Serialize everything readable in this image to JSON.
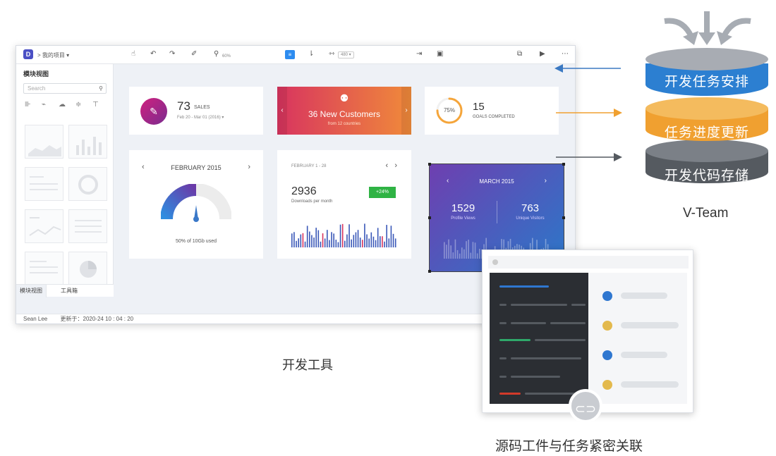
{
  "toolbar": {
    "logo": "D",
    "breadcrumb": "> 我的项目 ▾",
    "zoom": "60%",
    "select_value": "480 ▾"
  },
  "sidebar": {
    "title": "模块视图",
    "search_placeholder": "Search",
    "tabs": [
      "模块视图",
      "工具箱"
    ]
  },
  "status_bar": {
    "user": "Sean Lee",
    "updated": "更新于：2020-24 10 : 04 : 20"
  },
  "cards": {
    "sales": {
      "value": "73",
      "label": "SALES",
      "range": "Feb 20 - Mar 01 (2016) ▾"
    },
    "customers": {
      "title": "36 New Customers",
      "subtitle": "from 12 countries"
    },
    "goals": {
      "percent": "75%",
      "value": "15",
      "label": "GOALS COMPLETED",
      "progress": 0.75
    },
    "storage": {
      "month": "FEBRUARY 2015",
      "usage": "50% of 10Gb used",
      "level": 0.5
    },
    "downloads": {
      "range": "FEBRUARY 1 - 28",
      "value": "2936",
      "label": "Downloads per month",
      "delta": "+24%"
    },
    "visitors": {
      "month": "MARCH 2015",
      "views": "1529",
      "views_label": "Profile Views",
      "unique": "763",
      "unique_label": "Unique Visitors"
    }
  },
  "stack": {
    "layers": [
      "开发任务安排",
      "任务进度更新",
      "开发代码存储"
    ],
    "name": "V-Team"
  },
  "captions": {
    "tool": "开发工具",
    "link": "源码工件与任务紧密关联"
  },
  "colors": {
    "stack_blue": "#2c7fd1",
    "stack_orange": "#f0a030",
    "stack_gray": "#555a60",
    "arrow_blue": "#3b79c2",
    "arrow_orange": "#f0a030",
    "arrow_dark": "#555a60"
  }
}
